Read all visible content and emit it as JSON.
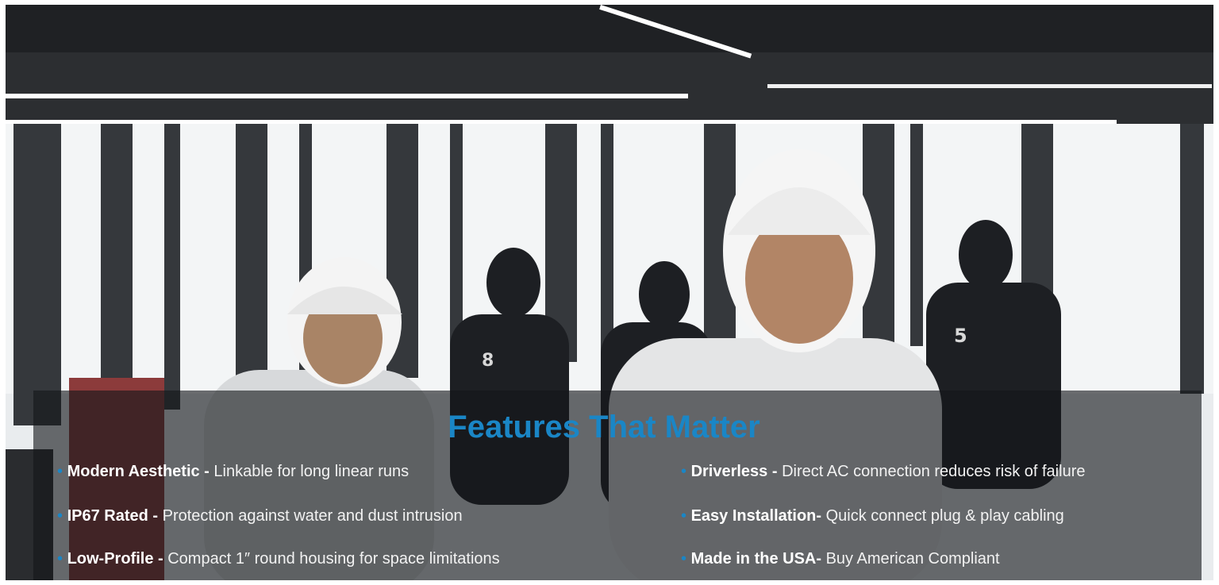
{
  "heading": "Features That Matter",
  "features": [
    {
      "label": "Modern Aesthetic -",
      "description": "Linkable for long linear runs"
    },
    {
      "label": "IP67 Rated -",
      "description": "Protection against water and dust intrusion"
    },
    {
      "label": "Low-Profile -",
      "description": "Compact 1″ round housing for space limitations"
    },
    {
      "label": "Driverless -",
      "description": "Direct AC connection reduces risk of failure"
    },
    {
      "label": "Easy Installation-",
      "description": "Quick connect plug & play cabling"
    },
    {
      "label": "Made in the USA-",
      "description": "Buy American Compliant"
    }
  ],
  "bullet": "•",
  "colors": {
    "accent": "#1a86c6",
    "overlay": "#14161a",
    "text": "#f2f2f2"
  }
}
